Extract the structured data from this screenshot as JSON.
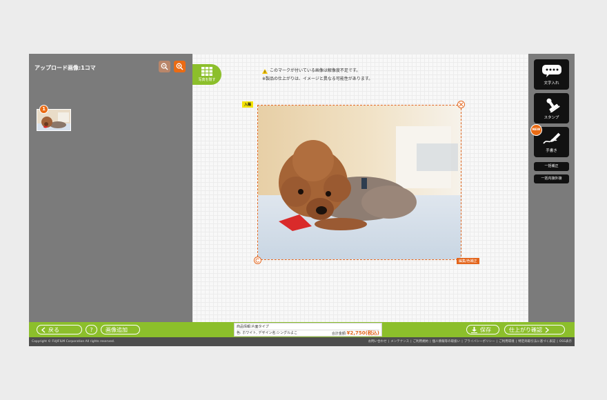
{
  "left_panel": {
    "title": "アップロード画像:1コマ",
    "thumb_badge": "1"
  },
  "canvas": {
    "photo_list_label": "写真を隠す",
    "notice_1": "このマークが付いている画像は解像度不足です。",
    "notice_2": "※製品の仕上がりは、イメージと異なる可能性があります。",
    "tag_in": "入稿",
    "edit_tag": "編集/色補正"
  },
  "right_panel": {
    "tools": [
      {
        "label": "文字入れ",
        "icon": "speech-bubble-icon"
      },
      {
        "label": "スタンプ",
        "icon": "stamp-icon"
      },
      {
        "label": "手書き",
        "icon": "pen-icon"
      }
    ],
    "new_badge": "NEW",
    "adjust_label": "一括補正",
    "outer_label": "一括内接外接"
  },
  "bottom_bar": {
    "back_label": "戻る",
    "help_label": "?",
    "add_label": "画像追加",
    "product_line1": "商品情報:片面タイプ",
    "product_line2": "色: ホワイト, デザイン名:シングルよこ",
    "total_label": "合計金額:",
    "price": "¥2,750(税込)",
    "save_label": "保存",
    "confirm_label": "仕上がり確認"
  },
  "footer": {
    "copyright": "Copyright © FUJIFILM Corporation All rights reserved.",
    "links": [
      "お問い合わせ",
      "メンテナンス",
      "ご利用規約",
      "個人情報等の取扱い",
      "プライバシーポリシー",
      "ご利用環境",
      "特定商取引法に基づく表記",
      "OSS表示"
    ]
  },
  "colors": {
    "accent_green": "#8cbf2b",
    "accent_orange": "#ea6b14",
    "panel_gray": "#7b7b7b",
    "tool_black": "#111111"
  }
}
